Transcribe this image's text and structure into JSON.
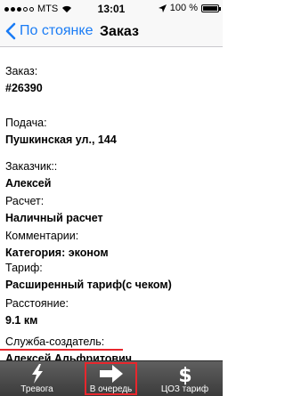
{
  "status_bar": {
    "carrier": "MTS",
    "time": "13:01",
    "battery": "100 %",
    "battery_level": 1.0
  },
  "nav": {
    "back_label": "По стоянке",
    "title": "Заказ"
  },
  "fields": [
    {
      "label": "Заказ:",
      "value": "#26390"
    },
    {
      "label": "Подача:",
      "value": "Пушкинская ул., 144"
    },
    {
      "label": "Заказчик::",
      "value": "Алексей"
    },
    {
      "label": "Расчет:",
      "value": "Наличный расчет"
    },
    {
      "label": "Комментарии:",
      "value": "Категория: эконом"
    },
    {
      "label": "Тариф:",
      "value": "Расширенный тариф(с чеком)"
    },
    {
      "label": "Расстояние:",
      "value": "9.1 км"
    },
    {
      "label": "Служба-создатель:",
      "value": "Алексей Альфритович"
    }
  ],
  "tabbar": {
    "tabs": [
      {
        "label": "Тревога",
        "icon": "lightning-icon"
      },
      {
        "label": "В очередь",
        "icon": "arrow-right-icon"
      },
      {
        "label": "ЦОЗ тариф",
        "icon": "dollar-icon"
      }
    ],
    "selected": 1
  },
  "colors": {
    "ios_blue": "#1a7cf5",
    "highlight_red": "#e8262c",
    "tabbar_dark": "#3a3a3a"
  }
}
